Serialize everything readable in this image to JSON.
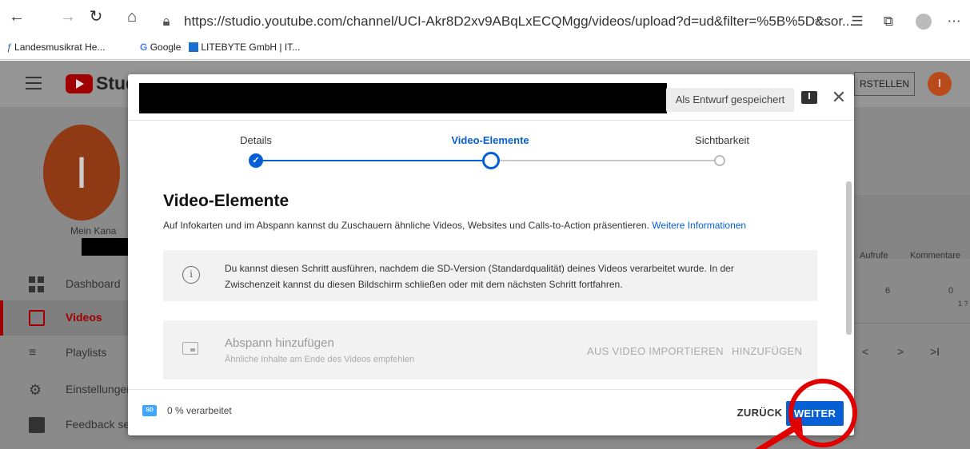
{
  "browser": {
    "url": "https://studio.youtube.com/channel/UCI-Akr8D2xv9ABqLxECQMgg/videos/upload?d=ud&filter=%5B%5D&sor...",
    "bookmarks": [
      "Landesmusikrat He...",
      "Google",
      "LITEBYTE GmbH | IT..."
    ]
  },
  "studio": {
    "logo_text": "Stud",
    "create_label": "RSTELLEN",
    "avatar_letter": "I",
    "channel_avatar_letter": "I",
    "channel_name": "Mein Kana",
    "sidebar": [
      "Dashboard",
      "Videos",
      "Playlists",
      "Einstellungen",
      "Feedback sen"
    ],
    "table_headers": [
      "Aufrufe",
      "Kommentare"
    ],
    "row_values": [
      "6",
      "0"
    ],
    "row_extra": "1 ?",
    "pager": [
      "<",
      ">",
      ">I"
    ]
  },
  "modal": {
    "draft_label": "Als Entwurf gespeichert",
    "steps": [
      "Details",
      "Video-Elemente",
      "Sichtbarkeit"
    ],
    "active_step": 1,
    "title": "Video-Elemente",
    "description": "Auf Infokarten und im Abspann kannst du Zuschauern ähnliche Videos, Websites und Calls-to-Action präsentieren.",
    "more_info_link": "Weitere Informationen",
    "info_text": "Du kannst diesen Schritt ausführen, nachdem die SD-Version (Standardqualität) deines Videos verarbeitet wurde. In der Zwischenzeit kannst du diesen Bildschirm schließen oder mit dem nächsten Schritt fortfahren.",
    "endscreen_title": "Abspann hinzufügen",
    "endscreen_subtitle": "Ähnliche Inhalte am Ende des Videos empfehlen",
    "import_label": "AUS VIDEO IMPORTIEREN",
    "add_label": "HINZUFÜGEN",
    "sd_badge": "SD",
    "processed_text": "0 % verarbeitet",
    "back_label": "ZURÜCK",
    "next_label": "WEITER"
  },
  "colors": {
    "accent_blue": "#065fd4",
    "annotation_red": "#e10000",
    "youtube_red": "#ff0000"
  }
}
